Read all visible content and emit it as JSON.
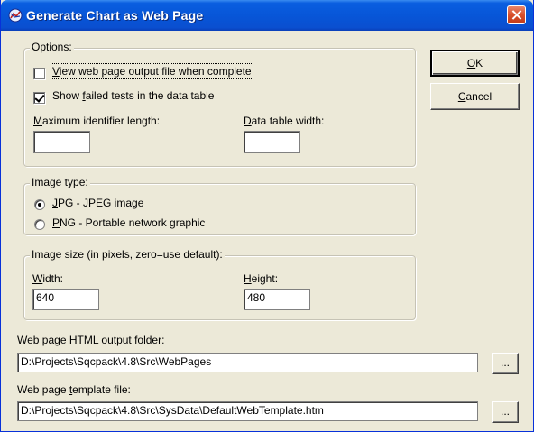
{
  "window": {
    "title": "Generate Chart as Web Page"
  },
  "options": {
    "legend": "Options:",
    "view_output": {
      "pre": "",
      "key": "V",
      "post": "iew web page output file when complete",
      "checked": false
    },
    "show_failed": {
      "pre": "Show ",
      "key": "f",
      "post": "ailed tests in the data table",
      "checked": true
    },
    "max_id_len": {
      "key": "M",
      "post": "aximum identifier length:",
      "value": ""
    },
    "data_width": {
      "key": "D",
      "post": "ata table width:",
      "value": ""
    }
  },
  "image_type": {
    "legend": "Image type:",
    "jpg": {
      "key": "J",
      "post": "PG - JPEG image",
      "selected": true
    },
    "png": {
      "key": "P",
      "post": "NG - Portable network graphic",
      "selected": false
    }
  },
  "image_size": {
    "legend": "Image size  (in pixels, zero=use default):",
    "width": {
      "key": "W",
      "post": "idth:",
      "value": "640"
    },
    "height": {
      "key": "H",
      "post": "eight:",
      "value": "480"
    }
  },
  "output_folder": {
    "pre": "Web page ",
    "key": "H",
    "post": "TML output folder:",
    "value": "D:\\Projects\\Sqcpack\\4.8\\Src\\WebPages"
  },
  "template_file": {
    "pre": "Web page ",
    "key": "t",
    "post": "emplate file:",
    "value": "D:\\Projects\\Sqcpack\\4.8\\Src\\SysData\\DefaultWebTemplate.htm"
  },
  "buttons": {
    "ok": {
      "key": "O",
      "post": "K"
    },
    "cancel": {
      "key": "C",
      "post": "ancel"
    },
    "browse": "..."
  },
  "colors": {
    "titlebar": "#0756d8",
    "dialog_bg": "#ece9d8",
    "close": "#d8502c"
  }
}
